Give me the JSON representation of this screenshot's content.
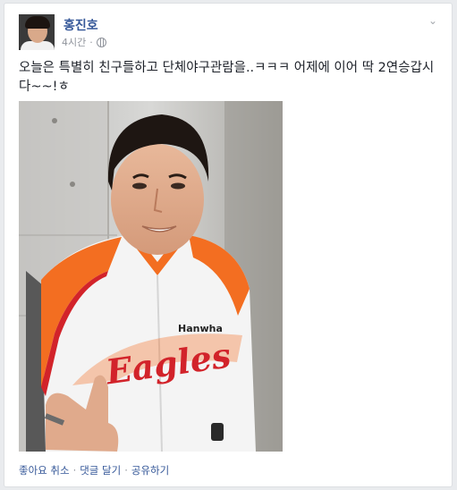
{
  "post": {
    "author": "홍진호",
    "time": "4시간",
    "separator": "·",
    "text": "오늘은 특별히 친구들하고 단체야구관람을..ㅋㅋㅋ 어제에 이어 딱 2연승갑시다~~!ㅎ",
    "privacy_icon": "globe-icon",
    "menu_icon": "chevron-down-icon"
  },
  "photo": {
    "jersey_team": "Eagles",
    "jersey_sponsor": "Hanwha"
  },
  "actions": {
    "like": "좋아요 취소",
    "comment": "댓글 달기",
    "share": "공유하기",
    "dot": "·"
  },
  "colors": {
    "link": "#365899",
    "meta": "#90949c",
    "jersey_orange": "#f36e21",
    "jersey_red": "#d2232a"
  }
}
